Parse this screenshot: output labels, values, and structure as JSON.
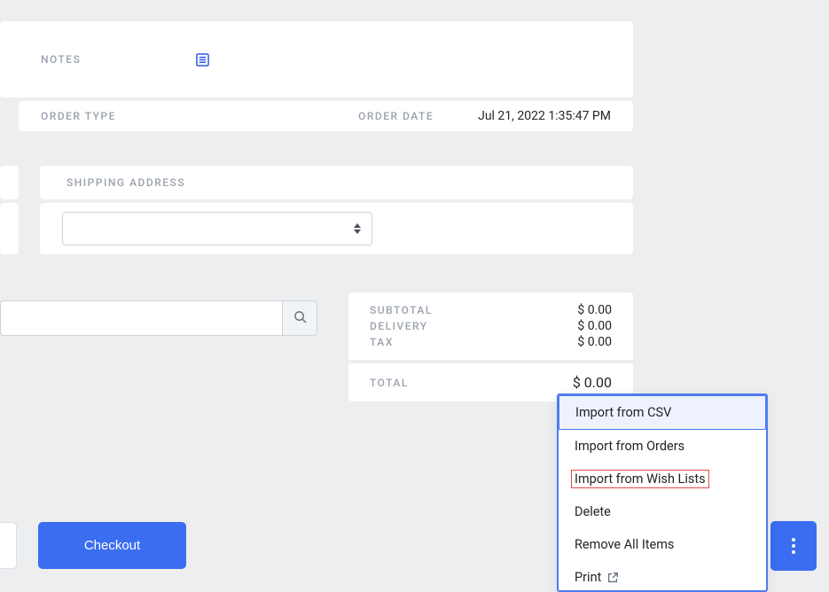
{
  "notes": {
    "label": "NOTES"
  },
  "order": {
    "type_label": "ORDER TYPE",
    "date_label": "ORDER DATE",
    "date_value": "Jul 21, 2022 1:35:47 PM"
  },
  "shipping": {
    "label": "SHIPPING ADDRESS"
  },
  "summary": {
    "subtotal_label": "SUBTOTAL",
    "subtotal_value": "$ 0.00",
    "delivery_label": "DELIVERY",
    "delivery_value": "$ 0.00",
    "tax_label": "TAX",
    "tax_value": "$ 0.00",
    "total_label": "TOTAL",
    "total_value": "$ 0.00"
  },
  "actions": {
    "checkout": "Checkout"
  },
  "menu": {
    "import_csv": "Import from CSV",
    "import_orders": "Import from Orders",
    "import_wishlists": "Import from Wish Lists",
    "delete": "Delete",
    "remove_all": "Remove All Items",
    "print": "Print"
  }
}
